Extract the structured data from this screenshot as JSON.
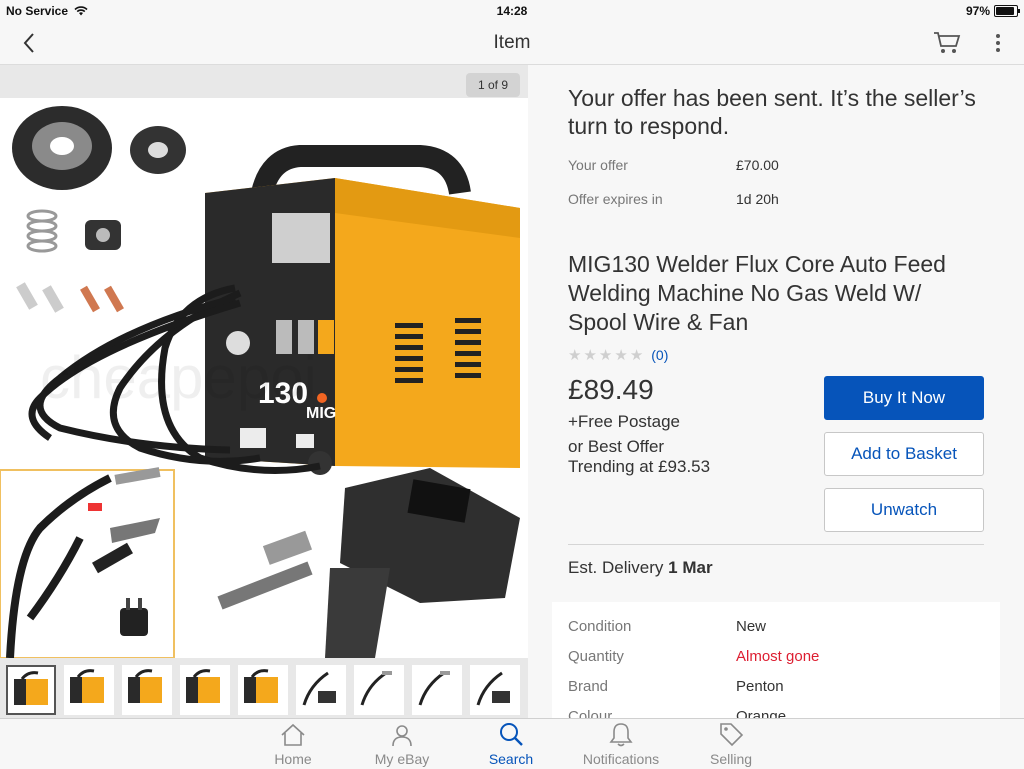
{
  "status_bar": {
    "carrier": "No Service",
    "time": "14:28",
    "battery": "97%",
    "battery_level": 0.97
  },
  "nav": {
    "title": "Item",
    "back_icon": "chevron-left-icon",
    "cart_icon": "cart-icon",
    "more_icon": "more-vertical-icon"
  },
  "gallery": {
    "counter": "1 of 9",
    "watermark": "cheapepoi",
    "thumbnail_count": 9,
    "selected_index": 1,
    "machine_label": "130",
    "machine_sub": "MIG"
  },
  "offer": {
    "message": "Your offer has been sent. It’s the seller’s turn to respond.",
    "rows": [
      {
        "label": "Your offer",
        "value": "£70.00"
      },
      {
        "label": "Offer expires in",
        "value": "1d 20h"
      }
    ]
  },
  "item": {
    "title": "MIG130 Welder Flux Core Auto Feed Welding Machine No Gas Weld W/ Spool Wire & Fan",
    "rating_count": "(0)",
    "stars": 0,
    "price": "£89.49",
    "postage": "+Free Postage",
    "best_offer": "or Best Offer",
    "trending": "Trending at £93.53"
  },
  "buttons": {
    "buy_now": "Buy It Now",
    "add_basket": "Add to Basket",
    "unwatch": "Unwatch"
  },
  "delivery": {
    "label": "Est. Delivery",
    "date": "1 Mar"
  },
  "specs": [
    {
      "label": "Condition",
      "value": "New"
    },
    {
      "label": "Quantity",
      "value": "Almost gone"
    },
    {
      "label": "Brand",
      "value": "Penton"
    },
    {
      "label": "Colour",
      "value": "Orange"
    }
  ],
  "tabs": [
    {
      "label": "Home",
      "icon": "home-icon"
    },
    {
      "label": "My eBay",
      "icon": "user-icon"
    },
    {
      "label": "Search",
      "icon": "search-icon"
    },
    {
      "label": "Notifications",
      "icon": "bell-icon"
    },
    {
      "label": "Selling",
      "icon": "tag-icon"
    }
  ],
  "colors": {
    "accent": "#0654ba",
    "alert": "#dd1e31",
    "welder_orange": "#f4a81c"
  }
}
